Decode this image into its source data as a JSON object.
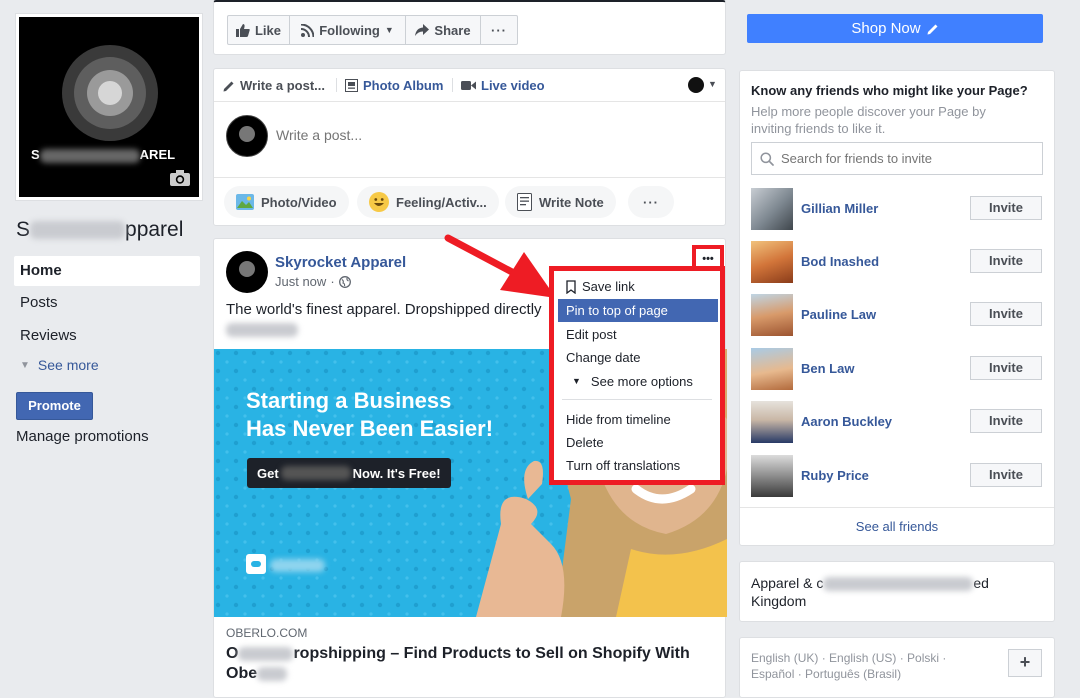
{
  "left": {
    "cover_text_left": "S",
    "cover_text_right": "AREL",
    "page_name_left": "S",
    "page_name_right": "pparel",
    "nav": [
      "Home",
      "Posts",
      "Reviews"
    ],
    "see_more": "See more",
    "promote": "Promote",
    "manage_promotions": "Manage promotions"
  },
  "topbar": {
    "like": "Like",
    "following": "Following",
    "share": "Share",
    "more": "···",
    "shop_now": "Shop Now"
  },
  "composer": {
    "write_post_tab": "Write a post...",
    "photo_album_tab": "Photo Album",
    "live_video_tab": "Live video",
    "placeholder": "Write a post...",
    "photo_video": "Photo/Video",
    "feeling": "Feeling/Activ...",
    "write_note": "Write Note",
    "more": "···"
  },
  "post": {
    "author": "Skyrocket Apparel",
    "time": "Just now",
    "text": "The world's finest apparel. Dropshipped directly",
    "headline_line1": "Starting a Business",
    "headline_line2": "Has Never Been Easier!",
    "cta_left": "Get",
    "cta_right": "Now. It's Free!",
    "domain": "OBERLO.COM",
    "link_title_left": "O",
    "link_title_mid": "ropshipping – Find Products to Sell on Shopify With",
    "link_title_line2": "Obe",
    "more_dots": "•••"
  },
  "menu": {
    "items": [
      "Save link",
      "Pin to top of page",
      "Edit post",
      "Change date",
      "See more options",
      "Hide from timeline",
      "Delete",
      "Turn off translations"
    ],
    "highlighted_index": 1
  },
  "invite": {
    "title": "Know any friends who might like your Page?",
    "subtitle": "Help more people discover your Page by inviting friends to like it.",
    "search_placeholder": "Search for friends to invite",
    "friends": [
      "Gillian Miller",
      "Bod Inashed",
      "Pauline Law",
      "Ben Law",
      "Aaron Buckley",
      "Ruby Price"
    ],
    "invite_label": "Invite",
    "see_all": "See all friends"
  },
  "about": {
    "line1_left": "Apparel & c",
    "line1_right": "ed",
    "line2": "Kingdom"
  },
  "languages": {
    "line1": "English (UK) · English (US) · Polski ·",
    "line2": "Español · Português (Brasil)",
    "plus": "+"
  },
  "colors": {
    "fb_blue": "#4267b2",
    "link_blue": "#365899",
    "shop_blue": "#4080ff",
    "highlight_red": "#ee1c24",
    "image_cyan": "#29b3e4"
  }
}
